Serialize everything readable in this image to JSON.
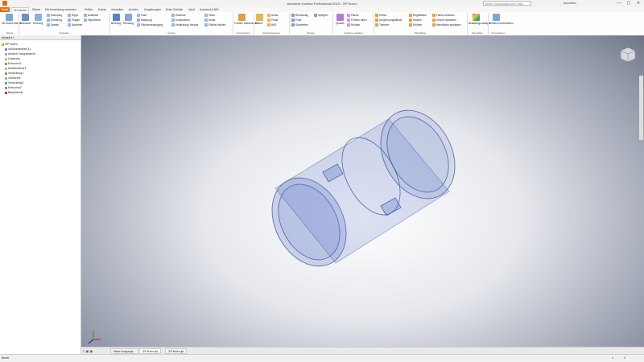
{
  "window": {
    "title": "Autodesk Inventor Professional 2019 - 3/P Noreo",
    "search_placeholder": "Befehl, Schlüsselwort oder Frage eingeben",
    "user": "Anmelden",
    "controls": [
      "—",
      "▢",
      "✕"
    ]
  },
  "menu": {
    "tabs": [
      "Datei",
      "3D-Modell",
      "Skizze",
      "Mit Anmerkung versehen",
      "Prüfen",
      "Extras",
      "Verwalten",
      "Ansicht",
      "Umgebungen",
      "Erste Schritte",
      "Vault",
      "Autodesk A360"
    ]
  },
  "ribbon": {
    "sketch": {
      "big": [
        "2D-Skizze starten"
      ],
      "panel": "Skizze"
    },
    "create": {
      "big": [
        "Extrusion",
        "Drehung"
      ],
      "small": [
        "Sweeping",
        "Erhebung",
        "Spirale",
        "Rippe",
        "Prägen",
        "Abziehen",
        "Aufkleber",
        "Importieren"
      ],
      "panel": "Erstellen"
    },
    "modify": {
      "big": [
        "Bohrung",
        "Rundung"
      ],
      "small": [
        "Fase",
        "Wandung",
        "Flächenverjüngung",
        "Gewinde",
        "Kombinieren",
        "Verdickung/ Versatz",
        "Teilen",
        "Direkt",
        "Fläche löschen"
      ],
      "panel": "Ändern"
    },
    "explore": {
      "big": [
        "Formen untersuchen"
      ],
      "panel": "Untersuchen"
    },
    "work": {
      "big": [
        "Ebene"
      ],
      "small": [
        "Achse",
        "Punkt",
        "BKS"
      ],
      "panel": "Arbeitselemente"
    },
    "pattern": {
      "small": [
        "Rechteckig",
        "Polar",
        "Skizziertes",
        "Spiegeln"
      ],
      "panel": "Muster"
    },
    "freeform": {
      "big": [
        "Quader"
      ],
      "panel": "Freiform erstellen"
    },
    "surface": {
      "small": [
        "Fläche",
        "Formen füllen",
        "Runden",
        "Heften",
        "Umgrenzungsfläche",
        "Trimmen",
        "Regelfläche",
        "Stutzen",
        "Dehnen",
        "Fläche ersetzen",
        "Körper reparieren",
        "Mehrfläche anpassen"
      ],
      "panel": "Oberfläche"
    },
    "simulation": {
      "big": [
        "Belastungs-analyse"
      ],
      "panel": "Simulation"
    },
    "convert": {
      "big": [
        "In Blech konvertieren"
      ],
      "panel": "Konvertieren"
    }
  },
  "browser": {
    "header": "Modell",
    "items": [
      "3/P Noreo",
      "Volumenkörper(1)",
      "Ansicht: Hauptansicht",
      "Ursprung",
      "Extrusion1",
      "Arbeitsebene1",
      "Verdickung1",
      "Gelöscht1",
      "Verdickung2",
      "Extrusion2",
      "Bauteilende"
    ]
  },
  "tabs": {
    "items": [
      "Meine Ausgangs...",
      "3/P Noreo.ipt",
      "3/P Noreo.ipt"
    ]
  },
  "status": {
    "left": "Bereit",
    "right": [
      "1",
      "2"
    ]
  },
  "colors": {
    "file_tab": "#e96b0c",
    "part_fill": "#5f78c8",
    "part_stroke": "#3a4f95"
  }
}
